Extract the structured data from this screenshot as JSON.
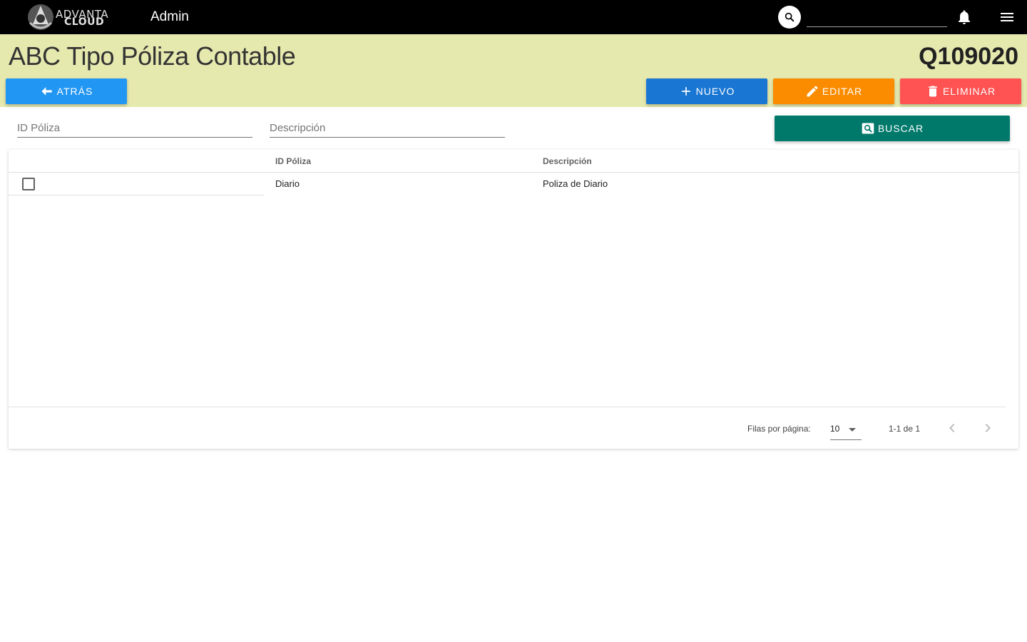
{
  "topbar": {
    "logo_line1": "ADVANTA",
    "logo_line2": "CLOUD",
    "app_name": "Admin",
    "search_placeholder": "",
    "icons": [
      "search-icon",
      "bell-icon",
      "menu-icon"
    ]
  },
  "header": {
    "title": "ABC Tipo Póliza Contable",
    "code": "Q109020",
    "back_label": "ATRÁS",
    "new_label": "NUEVO",
    "edit_label": "EDITAR",
    "delete_label": "ELIMINAR"
  },
  "filters": {
    "id_placeholder": "ID Póliza",
    "desc_placeholder": "Descripción",
    "search_label": "BUSCAR"
  },
  "table": {
    "columns": [
      "ID Póliza",
      "Descripción"
    ],
    "rows": [
      {
        "id": "Diario",
        "description": "Poliza de Diario",
        "checked": false
      }
    ]
  },
  "pagination": {
    "rows_per_page_label": "Filas por página:",
    "rows_per_page": "10",
    "range": "1-1 de 1"
  },
  "colors": {
    "topbar": "#000000",
    "header_band": "#e6e9ae",
    "back": "#2196f3",
    "new": "#1976d2",
    "edit": "#fb8c00",
    "delete": "#ff5252",
    "search": "#00796b"
  }
}
